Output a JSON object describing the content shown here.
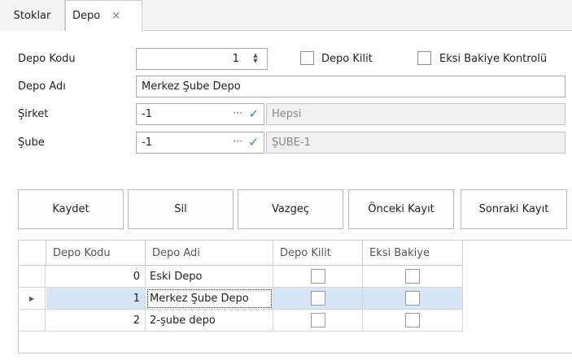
{
  "tabs": [
    {
      "label": "Stoklar",
      "active": false
    },
    {
      "label": "Depo",
      "active": true,
      "close": "×"
    }
  ],
  "form": {
    "depo_kodu_label": "Depo Kodu",
    "depo_kodu_value": "1",
    "depo_kilit_label": "Depo Kilit",
    "eksi_bakiye_label": "Eksi Bakiye Kontrolü",
    "depo_adi_label": "Depo Adı",
    "depo_adi_value": "Merkez Şube Depo",
    "sirket_label": "Şirket",
    "sirket_value": "-1",
    "sirket_name": "Hepsi",
    "sube_label": "Şube",
    "sube_value": "-1",
    "sube_name": "ŞUBE-1",
    "lookup_ellipsis": "···",
    "lookup_check": "✓"
  },
  "buttons": {
    "kaydet": "Kaydet",
    "sil": "Sil",
    "vazgec": "Vazgeç",
    "onceki": "Önceki Kayıt",
    "sonraki": "Sonraki Kayıt"
  },
  "grid": {
    "columns": [
      "Depo Kodu",
      "Depo Adi",
      "Depo Kilit",
      "Eksi Bakiye"
    ],
    "rows": [
      {
        "kod": "0",
        "ad": "Eski Depo",
        "kilit": false,
        "eksi": false
      },
      {
        "kod": "1",
        "ad": "Merkez Şube Depo",
        "kilit": false,
        "eksi": false,
        "selected": true
      },
      {
        "kod": "2",
        "ad": "2-şube depo",
        "kilit": false,
        "eksi": false
      }
    ],
    "row_indicator": "▶"
  },
  "colors": {
    "accent": "#2f7fd6",
    "selected_row": "#d6e4f7"
  }
}
